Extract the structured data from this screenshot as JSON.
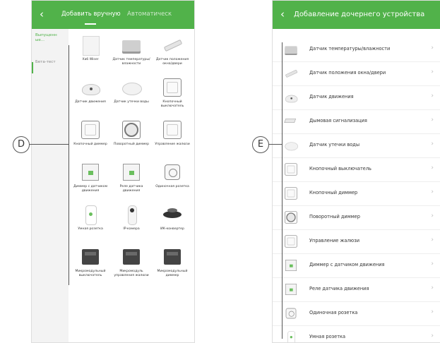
{
  "left_screen": {
    "tabs": [
      "Добавить вручную",
      "Автоматическ"
    ],
    "sidebar": [
      "Выпущенн ые...",
      "Бета-тест"
    ],
    "devices": [
      {
        "label": "Хаб Wiser",
        "icon": "hub-icon"
      },
      {
        "label": "Датчик температуры/ влажности",
        "icon": "temperature-sensor-icon"
      },
      {
        "label": "Датчик положения окна/двери",
        "icon": "door-window-sensor-icon"
      },
      {
        "label": "Датчик движения",
        "icon": "motion-sensor-icon"
      },
      {
        "label": "Датчик утечки воды",
        "icon": "water-leak-sensor-icon"
      },
      {
        "label": "Кнопочный выключатель",
        "icon": "push-button-switch-icon"
      },
      {
        "label": "Кнопочный диммер",
        "icon": "push-button-dimmer-icon"
      },
      {
        "label": "Поворотный диммер",
        "icon": "rotary-dimmer-icon"
      },
      {
        "label": "Управление жалюзи",
        "icon": "shutter-control-icon"
      },
      {
        "label": "Диммер с датчиком движения",
        "icon": "dimmer-motion-icon"
      },
      {
        "label": "Реле датчика движения",
        "icon": "motion-relay-icon"
      },
      {
        "label": "Одиночная розетка",
        "icon": "single-socket-icon"
      },
      {
        "label": "Умная розетка",
        "icon": "smart-plug-icon"
      },
      {
        "label": "IP-камера",
        "icon": "ip-camera-icon"
      },
      {
        "label": "ИК-конвертер",
        "icon": "ir-converter-icon"
      },
      {
        "label": "Микромодульный выключатель",
        "icon": "micromodule-switch-icon"
      },
      {
        "label": "Микромодуль управления жалюзи",
        "icon": "micromodule-shutter-icon"
      },
      {
        "label": "Микромодульный диммер",
        "icon": "micromodule-dimmer-icon"
      }
    ]
  },
  "right_screen": {
    "title": "Добавление дочернего устройства",
    "items": [
      {
        "label": "Датчик температуры/влажности",
        "icon": "temperature-sensor-icon"
      },
      {
        "label": "Датчик положения окна/двери",
        "icon": "door-window-sensor-icon"
      },
      {
        "label": "Датчик движения",
        "icon": "motion-sensor-icon"
      },
      {
        "label": "Дымовая сигнализация",
        "icon": "smoke-alarm-icon"
      },
      {
        "label": "Датчик утечки воды",
        "icon": "water-leak-sensor-icon"
      },
      {
        "label": "Кнопочный выключатель",
        "icon": "push-button-switch-icon"
      },
      {
        "label": "Кнопочный диммер",
        "icon": "push-button-dimmer-icon"
      },
      {
        "label": "Поворотный диммер",
        "icon": "rotary-dimmer-icon"
      },
      {
        "label": "Управление жалюзи",
        "icon": "shutter-control-icon"
      },
      {
        "label": "Диммер с датчиком движения",
        "icon": "dimmer-motion-icon"
      },
      {
        "label": "Реле датчика движения",
        "icon": "motion-relay-icon"
      },
      {
        "label": "Одиночная розетка",
        "icon": "single-socket-icon"
      },
      {
        "label": "Умная розетка",
        "icon": "smart-plug-icon"
      }
    ]
  },
  "callouts": [
    "D",
    "E"
  ],
  "colors": {
    "header": "#51b24a",
    "accent": "#51b24a"
  }
}
